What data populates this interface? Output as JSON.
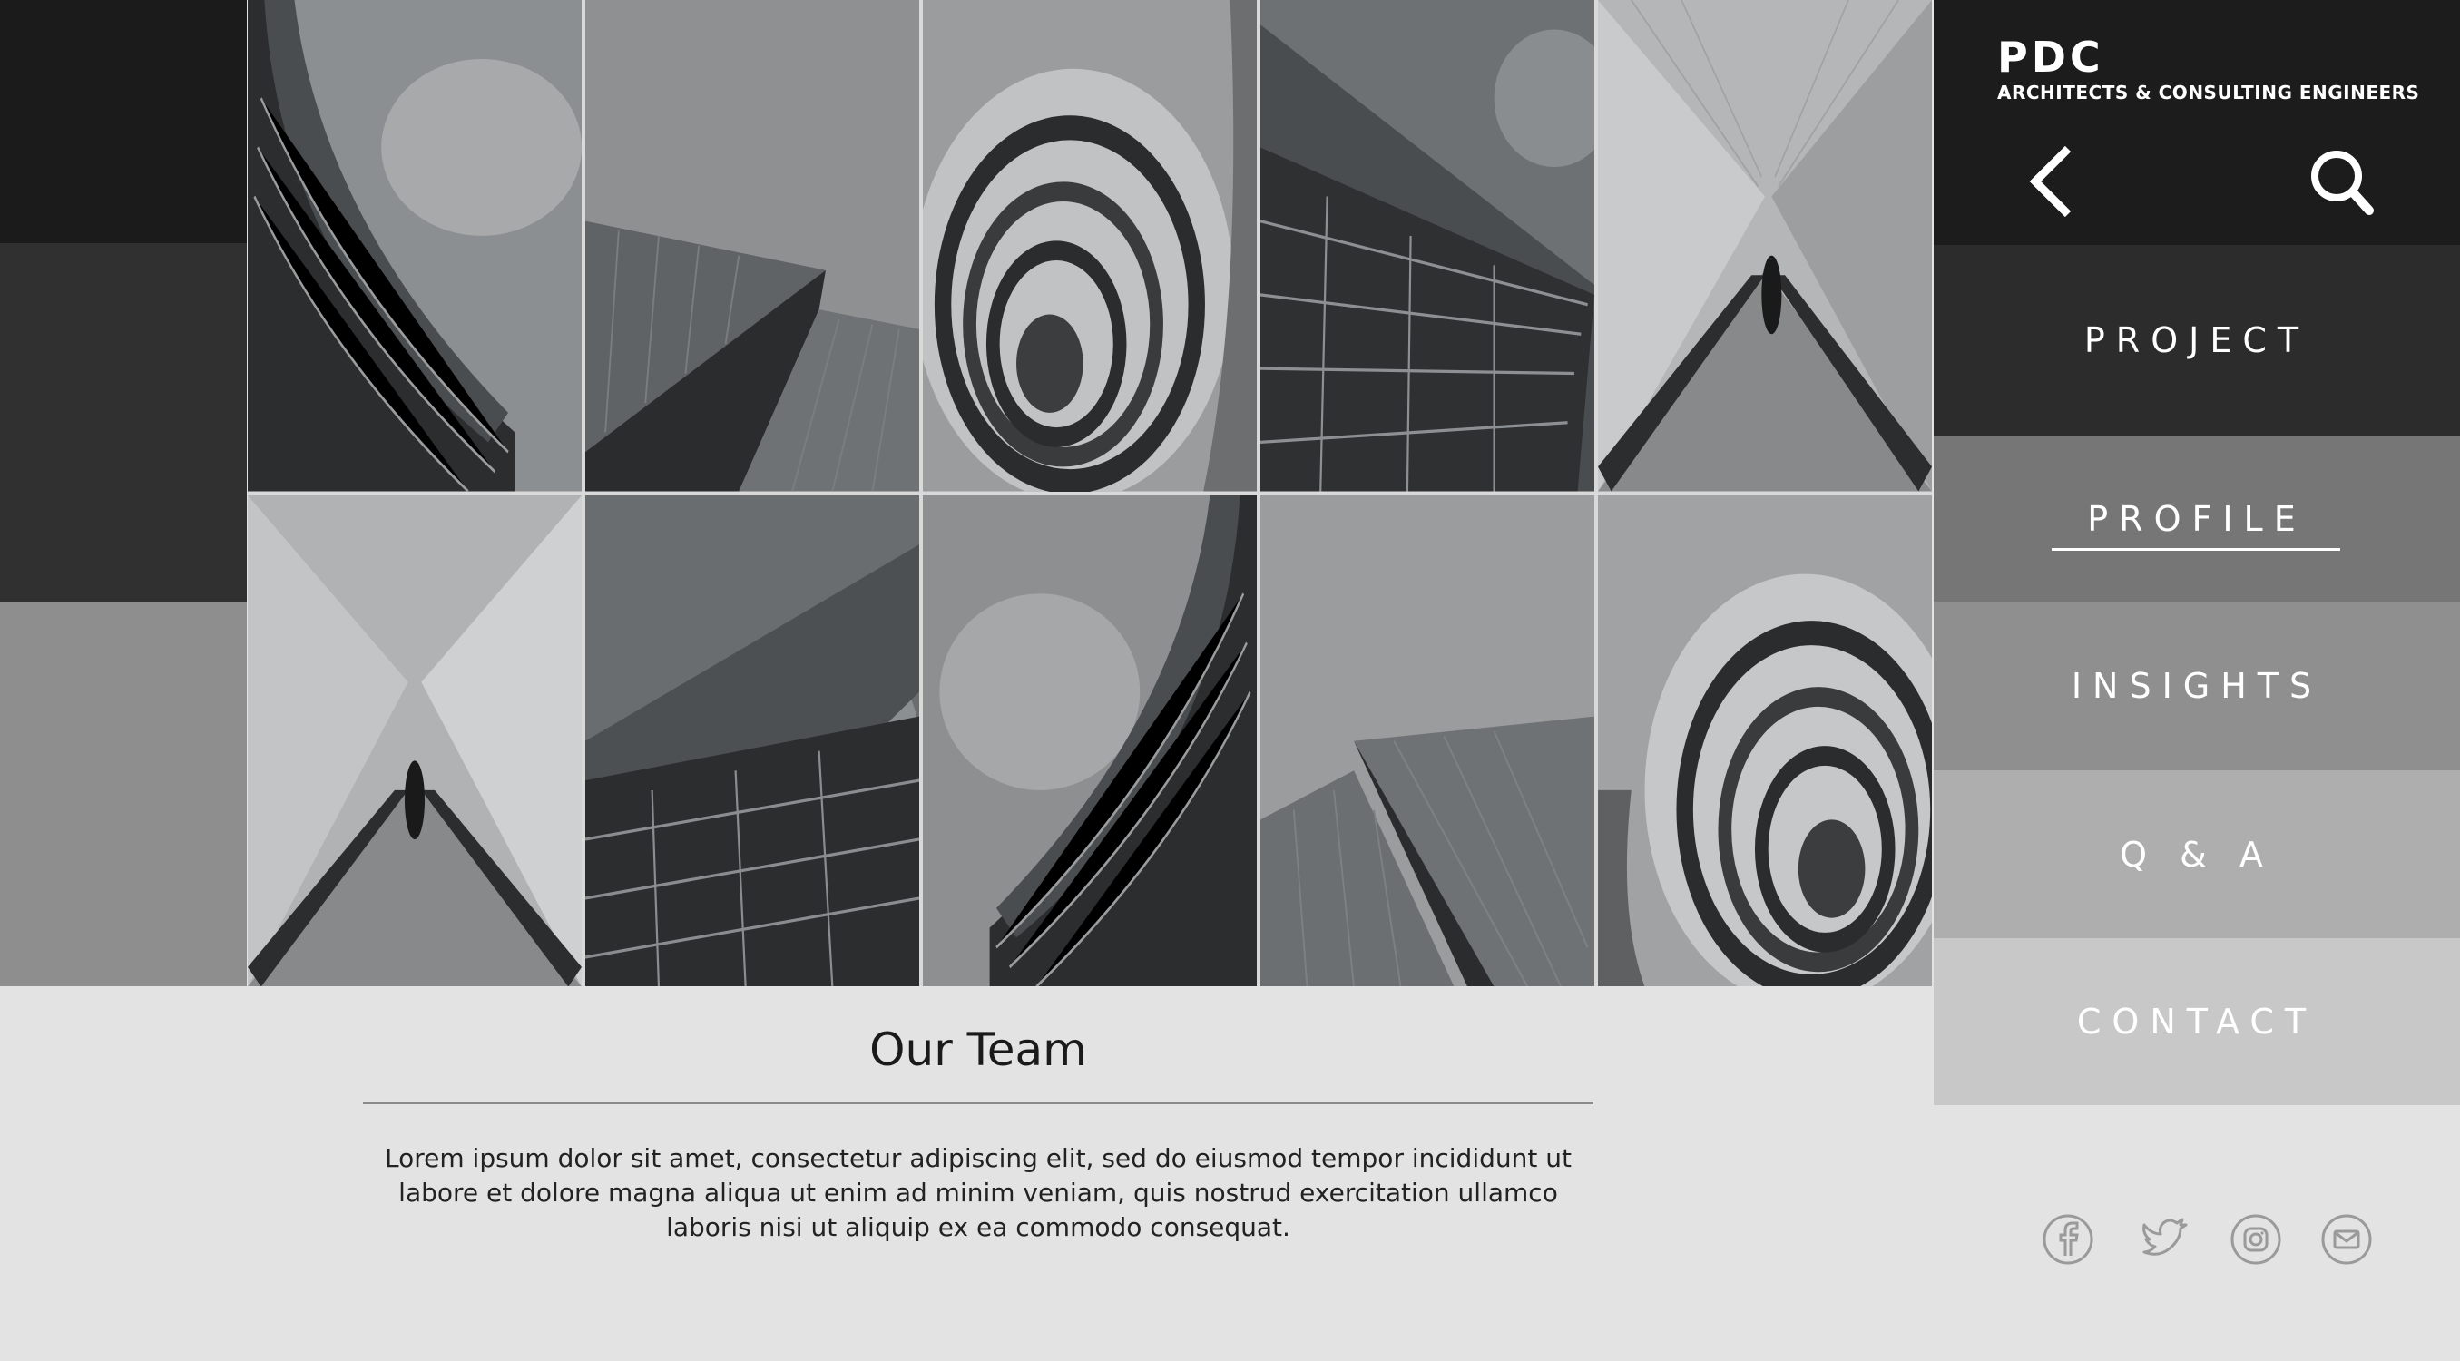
{
  "brand": {
    "name": "PDC",
    "tagline": "ARCHITECTS & CONSULTING ENGINEERS"
  },
  "header_icons": [
    "back-chevron-icon",
    "search-icon"
  ],
  "nav": {
    "items": [
      {
        "label": "PROJECT"
      },
      {
        "label": "PROFILE",
        "active": true
      },
      {
        "label": "INSIGHTS"
      },
      {
        "label": "Q & A"
      },
      {
        "label": "CONTACT"
      }
    ]
  },
  "team": {
    "title": "Our Team",
    "body": "Lorem ipsum dolor sit amet, consectetur adipiscing elit, sed do eiusmod tempor incididunt ut labore et dolore magna aliqua ut enim ad minim veniam, quis nostrud exercitation ullamco laboris nisi ut aliquip ex ea commodo consequat."
  },
  "social": [
    "facebook-icon",
    "twitter-icon",
    "instagram-icon",
    "email-icon"
  ],
  "colors": {
    "header_bg": "#1c1c1c",
    "nav_project": "#2c2c2c",
    "nav_profile": "#767676",
    "nav_insights": "#8f8f8f",
    "nav_qa": "#aeaeae",
    "nav_contact": "#c8c8c8",
    "page_bg": "#e3e3e3"
  }
}
